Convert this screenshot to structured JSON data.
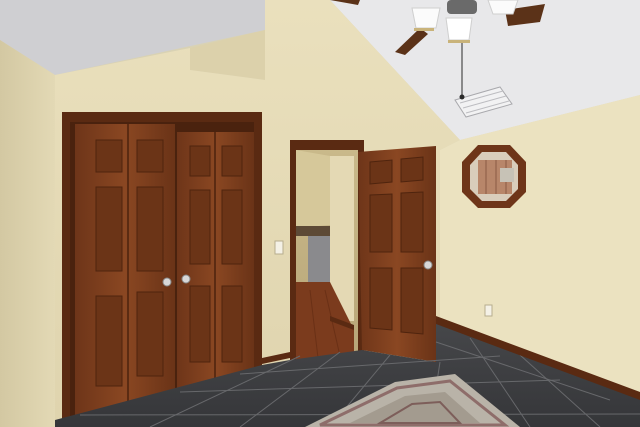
{
  "scene": {
    "subject": "bedroom-interior",
    "colors": {
      "wall": "#e6dcb8",
      "wall_shadow": "#cfc39c",
      "ceiling": "#e9e9ea",
      "ceiling_shadow": "#c9c9cc",
      "wood": "#7a3e1c",
      "wood_dark": "#5a2a12",
      "wood_light": "#9a5528",
      "tile": "#3f4043",
      "tile_grout": "#6b6c6e",
      "rug": "#b9b3a8",
      "hardwood": "#7b3b1d",
      "fan_blade": "#5b3218",
      "brass": "#c9b37a"
    },
    "objects": [
      "vaulted-ceiling",
      "ceiling-fan-with-lights",
      "air-vent",
      "bifold-closet-doors",
      "open-paneled-door",
      "hallway-with-hardwood-floor",
      "octagonal-window",
      "light-switch",
      "wall-outlet",
      "baseboard",
      "slate-tile-floor",
      "area-rug"
    ]
  }
}
